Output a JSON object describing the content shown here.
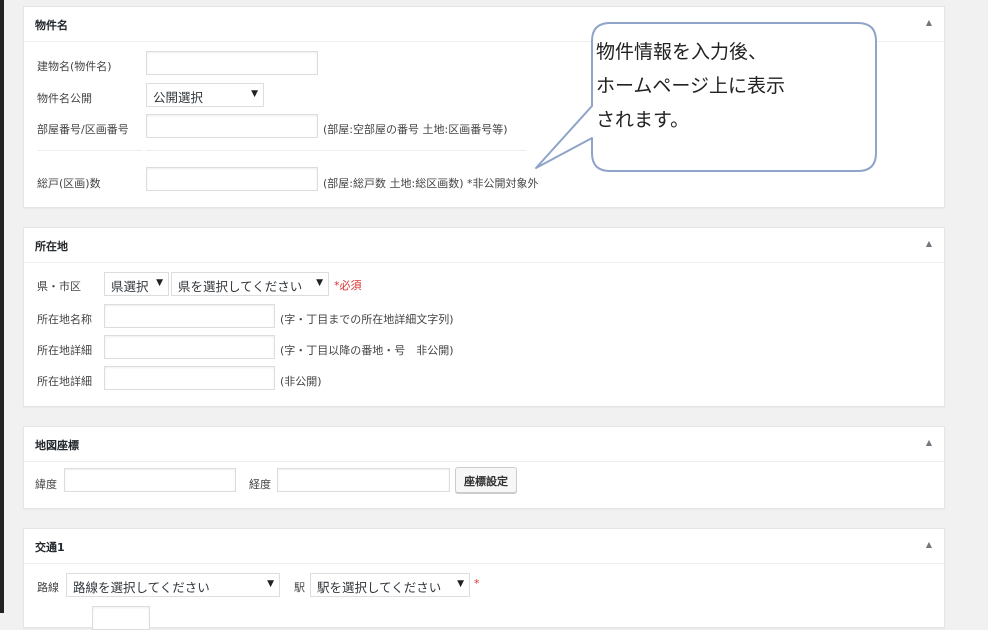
{
  "panels": {
    "property_name": {
      "title": "物件名",
      "building_name_label": "建物名(物件名)",
      "publish_label": "物件名公開",
      "publish_value": "公開選択",
      "room_number_label": "部屋番号/区画番号",
      "room_number_note": "(部屋:空部屋の番号 土地:区画番号等)",
      "units_label": "総戸(区画)数",
      "units_note": "(部屋:総戸数 土地:総区画数) *非公開対象外"
    },
    "location": {
      "title": "所在地",
      "pref_label": "県・市区",
      "pref_select": "県選択",
      "pref_select2": "県を選択してください",
      "required": "*必須",
      "address_name_label": "所在地名称",
      "address_name_note": "(字・丁目までの所在地詳細文字列)",
      "address_detail_label": "所在地詳細",
      "address_detail_note": "(字・丁目以降の番地・号　非公開)",
      "address_detail2_label": "所在地詳細",
      "address_detail2_note": "(非公開)"
    },
    "map": {
      "title": "地図座標",
      "lat_label": "緯度",
      "lng_label": "経度",
      "set_button": "座標設定"
    },
    "transport": {
      "title": "交通1",
      "line_label": "路線",
      "line_select": "路線を選択してください",
      "station_label": "駅",
      "station_select": "駅を選択してください",
      "required": "*"
    }
  },
  "callout": {
    "line1": "物件情報を入力後、",
    "line2": "ホームページ上に表示",
    "line3": "されます。"
  },
  "icons": {
    "toggle": "triangle-up-icon",
    "dropdown": "triangle-down-icon"
  },
  "colors": {
    "background": "#f1f1f1",
    "required": "#dc3232",
    "callout_border": "#8ea4c8"
  }
}
